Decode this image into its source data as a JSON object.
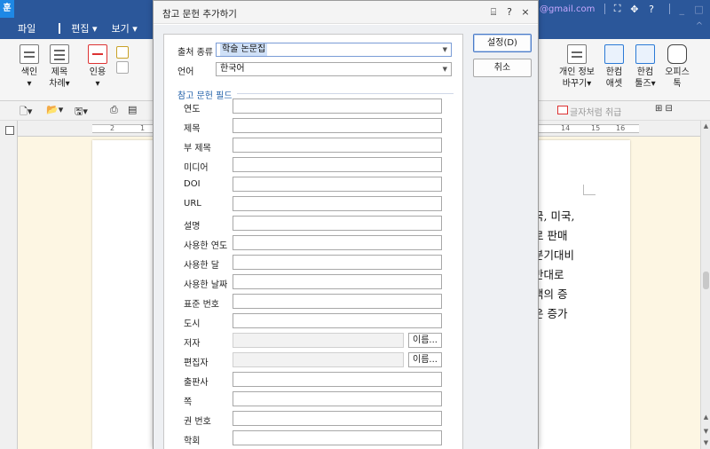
{
  "titlebar": {
    "app_badge": "훈",
    "email_fragment": "@gmail.com",
    "icons": [
      "expand-icon",
      "move-icon",
      "help-icon",
      "minimize-icon",
      "restore-icon"
    ],
    "help_glyph": "?",
    "min_glyph": "_",
    "max_glyph": "□"
  },
  "menubar": {
    "items": [
      "파일",
      "편집",
      "보기"
    ],
    "dropdown_glyph": "▾",
    "collapse_glyph": "^"
  },
  "ribbon": {
    "left_items": [
      {
        "label1": "색인",
        "label2": "▾",
        "icon": "index-icon"
      },
      {
        "label1": "제목",
        "label2": "차례▾",
        "icon": "title-toc-icon"
      },
      {
        "label1": "인용",
        "label2": "▾",
        "icon": "citation-icon"
      }
    ],
    "right_items": [
      {
        "label1": "개인 정보",
        "label2": "바꾸기▾",
        "icon": "privacy-icon"
      },
      {
        "label1": "한컴",
        "label2": "애셋",
        "icon": "hancom-asset-icon"
      },
      {
        "label1": "한컴",
        "label2": "툴즈▾",
        "icon": "hancom-tools-icon"
      },
      {
        "label1": "오피스",
        "label2": "톡",
        "icon": "office-talk-icon"
      }
    ]
  },
  "toolrow": {
    "style_text": "글자처럼 취급"
  },
  "ruler": {
    "left_nums": [
      "2",
      "1"
    ],
    "right_nums": [
      "14",
      "15",
      "16"
    ]
  },
  "document": {
    "lines": [
      "국, 미국,",
      "로 판매",
      "분기대비",
      "반대로",
      "액의 증",
      "은 증가"
    ]
  },
  "dialog": {
    "title": "참고 문헌 추가하기",
    "help_glyph": "?",
    "close_glyph": "×",
    "source_type_label": "출처 종류",
    "source_type_value": "학술 논문집",
    "language_label": "언어",
    "language_value": "한국어",
    "fields_header": "참고 문헌 필드",
    "fields": [
      {
        "label": "연도",
        "kind": "text"
      },
      {
        "label": "제목",
        "kind": "text"
      },
      {
        "label": "부 제목",
        "kind": "text"
      },
      {
        "label": "미디어",
        "kind": "text"
      },
      {
        "label": "DOI",
        "kind": "text"
      },
      {
        "label": "URL",
        "kind": "text"
      },
      {
        "label": "설명",
        "kind": "text"
      },
      {
        "label": "사용한 연도",
        "kind": "text"
      },
      {
        "label": "사용한 달",
        "kind": "text"
      },
      {
        "label": "사용한 날짜",
        "kind": "text"
      },
      {
        "label": "표준 번호",
        "kind": "text"
      },
      {
        "label": "도시",
        "kind": "text"
      },
      {
        "label": "저자",
        "kind": "name"
      },
      {
        "label": "편집자",
        "kind": "name"
      },
      {
        "label": "출판사",
        "kind": "text"
      },
      {
        "label": "쪽",
        "kind": "text"
      },
      {
        "label": "권 번호",
        "kind": "text"
      },
      {
        "label": "학회",
        "kind": "text"
      }
    ],
    "name_button_label": "이름...",
    "ok_button": "설정(D)",
    "cancel_button": "취소"
  }
}
